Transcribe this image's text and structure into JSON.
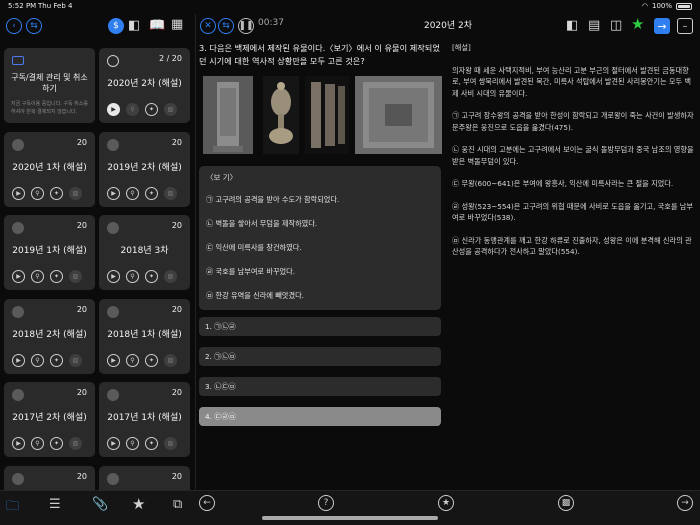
{
  "status": {
    "time": "5:52 PM",
    "date": "Thu Feb 4",
    "battery": "100%",
    "battery_level": 1.0
  },
  "left_toolbar": {
    "back_icon": "back-arrow-icon",
    "swap_icon": "swap-icon",
    "dollar_icon": "dollar-icon",
    "layout_icon": "split-view-icon",
    "book_icon": "book-icon",
    "grid_icon": "grid-icon"
  },
  "cards": [
    {
      "kind": "subscription",
      "title": "구독/결제 관리 및 취소하기",
      "desc": "지금 구독이용 중입니다. 구독 취소를 하셔야 반복 결제되지 않습니다."
    },
    {
      "kind": "exam",
      "title": "2020년 2차 (해설)",
      "count": "2 / 20",
      "active": true
    },
    {
      "kind": "exam",
      "title": "2020년 1차 (해설)",
      "count": "20"
    },
    {
      "kind": "exam",
      "title": "2019년 2차 (해설)",
      "count": "20"
    },
    {
      "kind": "exam",
      "title": "2019년 1차 (해설)",
      "count": "20"
    },
    {
      "kind": "exam",
      "title": "2018년 3차",
      "count": "20"
    },
    {
      "kind": "exam",
      "title": "2018년 2차 (해설)",
      "count": "20"
    },
    {
      "kind": "exam",
      "title": "2018년 1차 (해설)",
      "count": "20"
    },
    {
      "kind": "exam",
      "title": "2017년 2차 (해설)",
      "count": "20"
    },
    {
      "kind": "exam",
      "title": "2017년 1차 (해설)",
      "count": "20"
    },
    {
      "kind": "exam",
      "title": "",
      "count": "20"
    },
    {
      "kind": "exam",
      "title": "",
      "count": "20"
    }
  ],
  "right_toolbar": {
    "timer": "00:37",
    "title": "2020년 2차"
  },
  "question": {
    "text": "3. 다음은 백제에서 제작된 유물이다.〈보기〉에서 이 유물이 제작되었던 시기에 대한 역사적 상황만을 모두 고른 것은?",
    "bogi_head": "〈보 기〉",
    "bogi": [
      "㉠ 고구려의 공격을 받아 수도가 함락되었다.",
      "㉡ 벽돌을 쌓아서 무덤을 제작하였다.",
      "㉢ 익산에 미륵사를 창건하였다.",
      "㉣ 국호를 남부여로 바꾸었다.",
      "㉤ 한강 유역을 신라에 빼앗겼다."
    ],
    "choices": [
      {
        "label": "1. ㉠㉡㉣",
        "selected": false
      },
      {
        "label": "2. ㉠㉡㉤",
        "selected": false
      },
      {
        "label": "3. ㉡㉢㉤",
        "selected": false
      },
      {
        "label": "4. ㉢㉣㉤",
        "selected": true
      }
    ]
  },
  "explanation": {
    "head": "[해설]",
    "paragraphs": [
      "의자왕 때 세운 사택지적비, 부여 능산리 고분 부근의 절터에서 발견된 금동대향로, 부여 쌍북리에서 발견된 목간, 미륵사 석탑에서 발견된 사리봉안기는 모두 백제 사비 시대의 유물이다.",
      "㉠ 고구려 장수왕의 공격을 받아 한성이 함락되고 개로왕이 죽는 사건이 발생하자 문주왕은 웅진으로 도읍을 옮겼다(475).",
      "㉡ 웅진 시대의 고분에는 고구려에서 보이는 굴식 돌방무덤과 중국 남조의 영향을 받은 벽돌무덤이 있다.",
      "㉢ 무왕(600~641)은 부여에 왕흥사, 익산에 미륵사라는 큰 절을 지었다.",
      "㉣ 성왕(523~554)은 고구려의 위협 때문에 사비로 도읍을 옮기고, 국호를 남부여로 바꾸었다(538).",
      "㉤ 신라가 동맹관계를 깨고 한강 하류로 진출하자, 성왕은 이에 분격해 신라의 관산성을 공격하다가 전사하고 말았다(554)."
    ]
  },
  "colors": {
    "accent": "#2f7ff0",
    "bg": "#0b0b0b",
    "card": "#2a2a2a"
  }
}
